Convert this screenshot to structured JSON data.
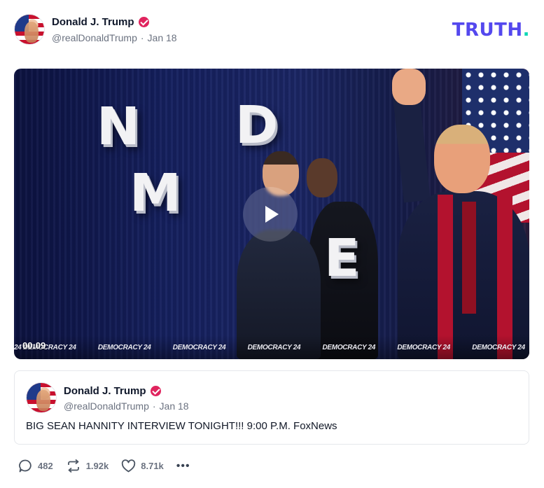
{
  "post": {
    "author_name": "Donald J. Trump",
    "handle": "@realDonaldTrump",
    "separator": "·",
    "date": "Jan 18"
  },
  "brand": {
    "text": "TRUTH",
    "dot": ".",
    "color": "#5448ee",
    "dot_color": "#0ed7b5"
  },
  "video": {
    "duration": "00:09",
    "stage_letters": [
      "N",
      "D",
      "M",
      "E"
    ],
    "banner": [
      "24 DEMOCRACY 24",
      "DEMOCRACY 24",
      "DEMOCRACY 24",
      "DEMOCRACY 24",
      "DEMOCRACY 24",
      "DEMOCRACY 24",
      "DEMOCRACY 24"
    ],
    "play_icon": "play-icon"
  },
  "quoted_post": {
    "author_name": "Donald J. Trump",
    "handle": "@realDonaldTrump",
    "separator": "·",
    "date": "Jan 18",
    "text": "BIG SEAN HANNITY INTERVIEW TONIGHT!!! 9:00 P.M. FoxNews"
  },
  "actions": {
    "replies": "482",
    "retruths": "1.92k",
    "likes": "8.71k",
    "more": "•••"
  },
  "icons": {
    "verified": "verified-badge-icon",
    "reply": "reply-bubble-icon",
    "retruth": "retruth-arrows-icon",
    "like": "heart-icon",
    "more": "more-dots-icon"
  },
  "colors": {
    "verified": "#e0245e",
    "muted_text": "#6b7280"
  }
}
